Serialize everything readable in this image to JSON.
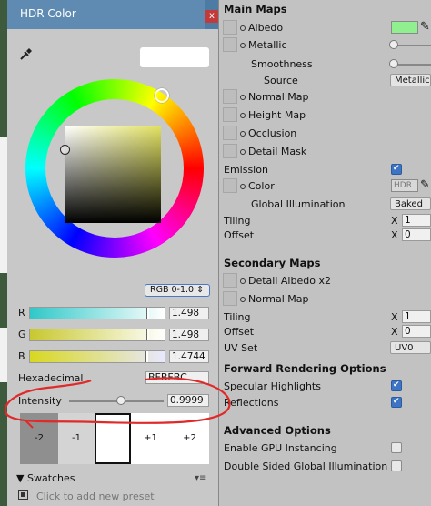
{
  "popup": {
    "title": "HDR Color",
    "close": "x",
    "mode_dropdown": "RGB 0-1.0",
    "channels": [
      {
        "label": "R",
        "value": "1.498",
        "marker": 0.88
      },
      {
        "label": "G",
        "value": "1.498",
        "marker": 0.88
      },
      {
        "label": "B",
        "value": "1.4744",
        "marker": 0.87
      }
    ],
    "hex_label": "Hexadecimal",
    "hex_value": "BFBFBC",
    "intensity_label": "Intensity",
    "intensity_value": "0.9999",
    "intensity_slider": 0.55,
    "exposure_swatches": [
      "-2",
      "-1",
      "",
      "+1",
      "+2"
    ],
    "swatches_label": "Swatches",
    "add_preset": "Click to add new preset",
    "colors": {
      "titlebar": "#4d7ba3",
      "close": "#c23b3b",
      "annotation": "#e02a2a",
      "selected_color": "#ffffff"
    }
  },
  "inspector": {
    "main_maps_header": "Main Maps",
    "albedo_label": "Albedo",
    "albedo_color": "#90f090",
    "metallic_label": "Metallic",
    "metallic_slider": 0.0,
    "smoothness_label": "Smoothness",
    "smoothness_slider": 0.0,
    "source_label": "Source",
    "source_value": "Metallic",
    "normal_map_label": "Normal Map",
    "height_map_label": "Height Map",
    "occlusion_label": "Occlusion",
    "detail_mask_label": "Detail Mask",
    "emission_label": "Emission",
    "emission_checked": true,
    "color_label": "Color",
    "color_field": "HDR",
    "gi_label": "Global Illumination",
    "gi_value": "Baked",
    "tiling_label": "Tiling",
    "offset_label": "Offset",
    "x_label": "X",
    "tiling_x": "1",
    "offset_x": "0",
    "secondary_maps_header": "Secondary Maps",
    "detail_albedo_label": "Detail Albedo x2",
    "secondary_normal_label": "Normal Map",
    "tiling2_x": "1",
    "offset2_x": "0",
    "uv_set_label": "UV Set",
    "uv_set_value": "UV0",
    "forward_header": "Forward Rendering Options",
    "specular_label": "Specular Highlights",
    "specular_checked": true,
    "reflections_label": "Reflections",
    "reflections_checked": true,
    "advanced_header": "Advanced Options",
    "gpu_instancing_label": "Enable GPU Instancing",
    "gpu_instancing_checked": false,
    "double_sided_label": "Double Sided Global Illumination",
    "double_sided_checked": false
  }
}
